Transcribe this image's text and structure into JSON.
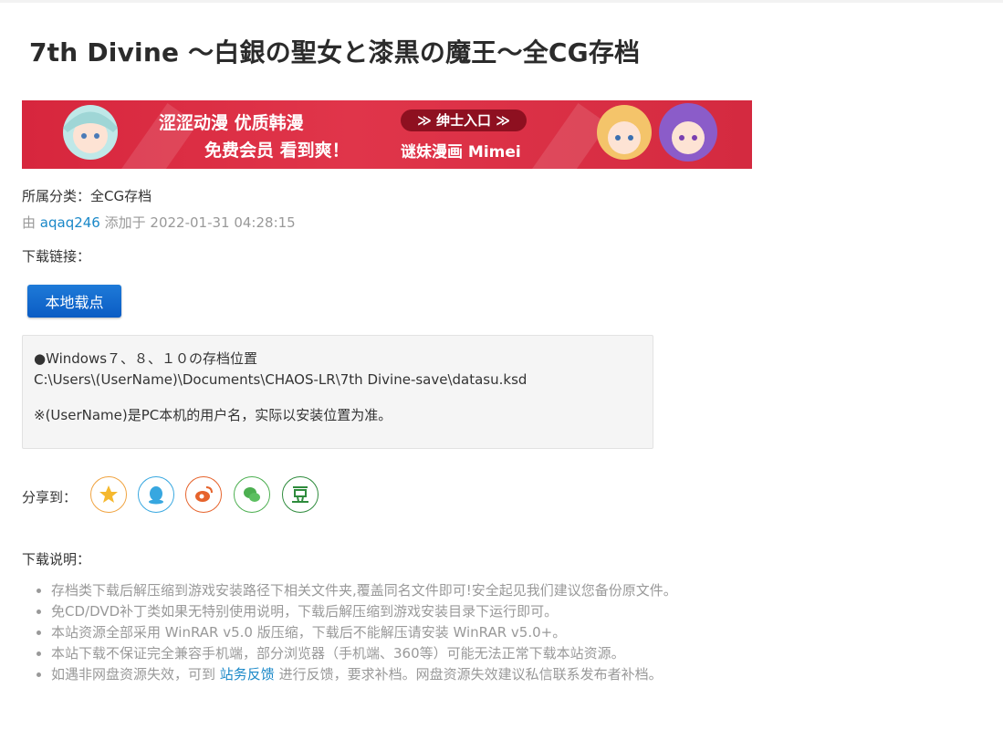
{
  "title": "7th Divine ～白銀の聖女と漆黒の魔王～全CG存档",
  "banner": {
    "line1": "涩涩动漫 优质韩漫",
    "line2": "免费会员 看到爽！",
    "pill": "≫ 绅士入口 ≫",
    "brand": "谜妹漫画 Mimei",
    "colors": {
      "bg": "#d7263d",
      "pill": "#8e1020"
    }
  },
  "meta": {
    "category_label": "所属分类：",
    "category": "全CG存档",
    "by": "由",
    "author": "aqaq246",
    "added_at": "添加于 2022-01-31 04:28:15"
  },
  "download": {
    "label": "下载链接：",
    "button": "本地载点"
  },
  "note": {
    "line1": "●Windows７、８、１０の存档位置",
    "line2": "C:\\Users\\(UserName)\\Documents\\CHAOS-LR\\7th Divine-save\\datasu.ksd",
    "line3": "※(UserName)是PC本机的用户名，实际以安装位置为准。"
  },
  "share": {
    "label": "分享到：",
    "icons": [
      "qzone-icon",
      "qq-icon",
      "weibo-icon",
      "wechat-icon",
      "douban-icon"
    ]
  },
  "notes": {
    "title": "下载说明：",
    "items": [
      "存档类下载后解压缩到游戏安装路径下相关文件夹,覆盖同名文件即可!安全起见我们建议您备份原文件。",
      "免CD/DVD补丁类如果无特别使用说明，下载后解压缩到游戏安装目录下运行即可。",
      "本站资源全部采用 WinRAR v5.0 版压缩，下载后不能解压请安装 WinRAR v5.0+。",
      "本站下载不保证完全兼容手机端，部分浏览器（手机端、360等）可能无法正常下载本站资源。"
    ],
    "last_prefix": "如遇非网盘资源失效，可到 ",
    "last_link": "站务反馈",
    "last_suffix": " 进行反馈，要求补档。网盘资源失效建议私信联系发布者补档。"
  },
  "colors": {
    "link": "#1a88c8",
    "button": "#0b5cc4",
    "muted": "#999999"
  }
}
